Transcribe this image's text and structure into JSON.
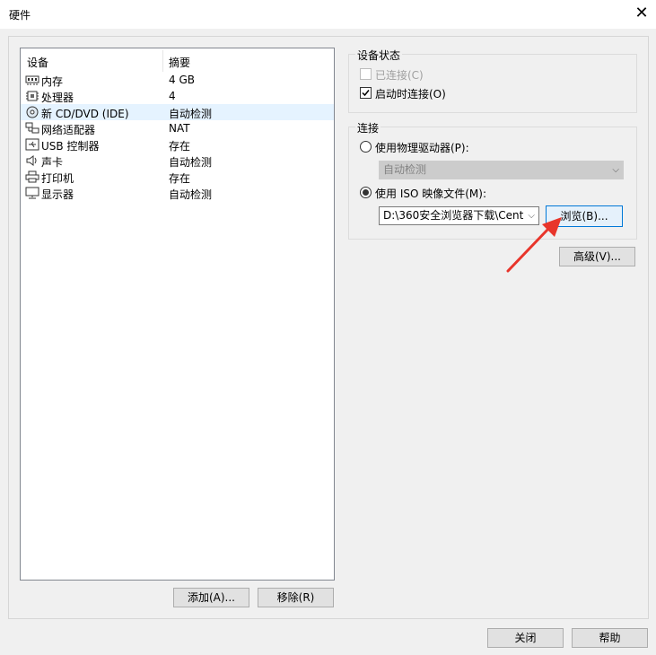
{
  "window": {
    "title": "硬件",
    "close_glyph": "✕"
  },
  "device_list": {
    "headers": {
      "device": "设备",
      "summary": "摘要"
    },
    "rows": [
      {
        "icon": "memory-icon",
        "device": "内存",
        "summary": "4 GB",
        "selected": false
      },
      {
        "icon": "processor-icon",
        "device": "处理器",
        "summary": "4",
        "selected": false
      },
      {
        "icon": "cd-dvd-icon",
        "device": "新 CD/DVD (IDE)",
        "summary": "自动检测",
        "selected": true
      },
      {
        "icon": "network-adapter-icon",
        "device": "网络适配器",
        "summary": "NAT",
        "selected": false
      },
      {
        "icon": "usb-icon",
        "device": "USB 控制器",
        "summary": "存在",
        "selected": false
      },
      {
        "icon": "sound-card-icon",
        "device": "声卡",
        "summary": "自动检测",
        "selected": false
      },
      {
        "icon": "printer-icon",
        "device": "打印机",
        "summary": "存在",
        "selected": false
      },
      {
        "icon": "display-icon",
        "device": "显示器",
        "summary": "自动检测",
        "selected": false
      }
    ]
  },
  "buttons": {
    "add": "添加(A)...",
    "remove": "移除(R)",
    "browse": "浏览(B)...",
    "advanced": "高级(V)...",
    "close": "关闭",
    "help": "帮助"
  },
  "device_status": {
    "legend": "设备状态",
    "connected": {
      "label": "已连接(C)",
      "checked": false,
      "enabled": false
    },
    "connect_at_power_on": {
      "label": "启动时连接(O)",
      "checked": true,
      "enabled": true
    }
  },
  "connection": {
    "legend": "连接",
    "physical_drive": {
      "label": "使用物理驱动器(P):",
      "selected": false,
      "combo_value": "自动检测"
    },
    "iso_image": {
      "label": "使用 ISO 映像文件(M):",
      "selected": true,
      "path_value": "D:\\360安全浏览器下载\\Cent"
    }
  },
  "colors": {
    "annotation_arrow": "#e8352b",
    "selection": "#e5f3ff",
    "focus_border": "#0078d7"
  }
}
